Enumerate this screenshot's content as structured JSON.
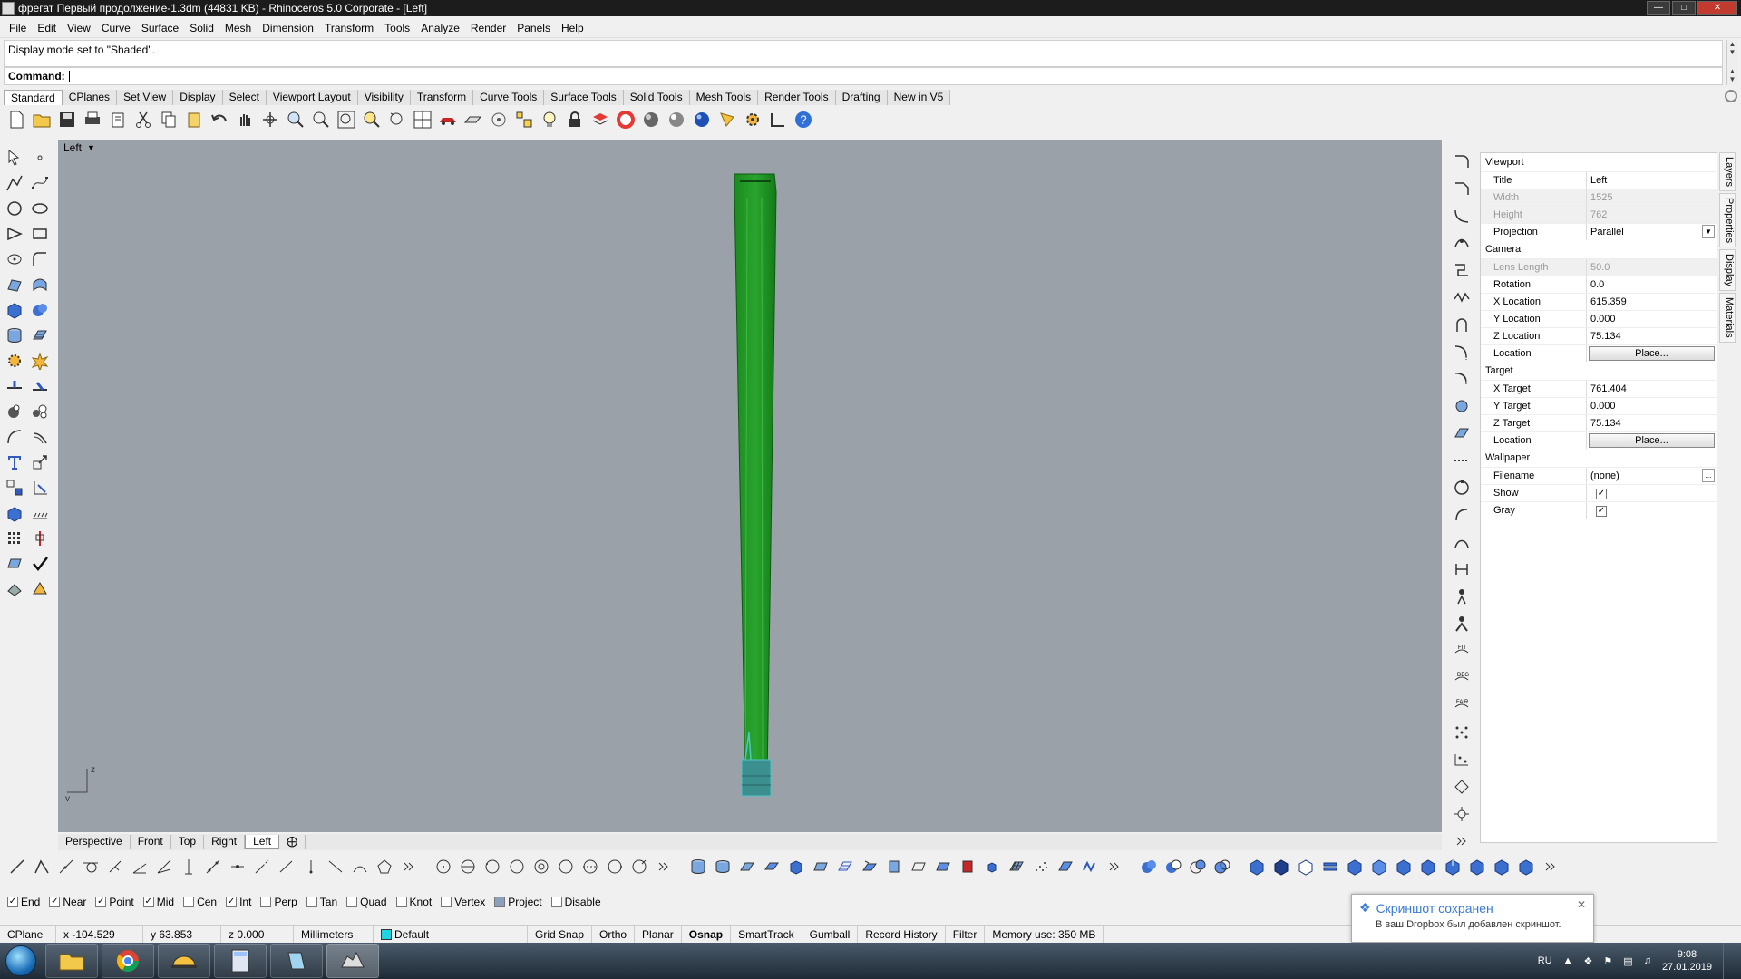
{
  "window": {
    "title": "фрегат Первый продолжение-1.3dm (44831 KB) - Rhinoceros  5.0 Corporate - [Left]"
  },
  "menu": [
    "File",
    "Edit",
    "View",
    "Curve",
    "Surface",
    "Solid",
    "Mesh",
    "Dimension",
    "Transform",
    "Tools",
    "Analyze",
    "Render",
    "Panels",
    "Help"
  ],
  "command": {
    "history": "Display mode set to \"Shaded\".",
    "label": "Command:",
    "value": ""
  },
  "toolbar_tabs": [
    "Standard",
    "CPlanes",
    "Set View",
    "Display",
    "Select",
    "Viewport Layout",
    "Visibility",
    "Transform",
    "Curve Tools",
    "Surface Tools",
    "Solid Tools",
    "Mesh Tools",
    "Render Tools",
    "Drafting",
    "New in V5"
  ],
  "active_toolbar_tab": "Standard",
  "viewport": {
    "name": "Left",
    "background": "#9ba1a9",
    "axis_labels": {
      "vertical": "z",
      "horizontal": "y"
    }
  },
  "viewport_tabs": [
    "Perspective",
    "Front",
    "Top",
    "Right",
    "Left"
  ],
  "active_viewport_tab": "Left",
  "properties": {
    "viewport_section": "Viewport",
    "title": {
      "label": "Title",
      "value": "Left"
    },
    "width": {
      "label": "Width",
      "value": "1525"
    },
    "height": {
      "label": "Height",
      "value": "762"
    },
    "projection": {
      "label": "Projection",
      "value": "Parallel"
    },
    "camera_section": "Camera",
    "lens_length": {
      "label": "Lens Length",
      "value": "50.0"
    },
    "rotation": {
      "label": "Rotation",
      "value": "0.0"
    },
    "x_location": {
      "label": "X Location",
      "value": "615.359"
    },
    "y_location": {
      "label": "Y Location",
      "value": "0.000"
    },
    "z_location": {
      "label": "Z Location",
      "value": "75.134"
    },
    "camera_location": {
      "label": "Location",
      "button": "Place..."
    },
    "target_section": "Target",
    "x_target": {
      "label": "X Target",
      "value": "761.404"
    },
    "y_target": {
      "label": "Y Target",
      "value": "0.000"
    },
    "z_target": {
      "label": "Z Target",
      "value": "75.134"
    },
    "target_location": {
      "label": "Location",
      "button": "Place..."
    },
    "wallpaper_section": "Wallpaper",
    "filename": {
      "label": "Filename",
      "value": "(none)",
      "button": "..."
    },
    "show": {
      "label": "Show",
      "checked": true
    },
    "gray": {
      "label": "Gray",
      "checked": true
    }
  },
  "side_tabs": [
    "Layers",
    "Properties",
    "Display",
    "Materials"
  ],
  "osnaps": [
    {
      "label": "End",
      "checked": true
    },
    {
      "label": "Near",
      "checked": true
    },
    {
      "label": "Point",
      "checked": true
    },
    {
      "label": "Mid",
      "checked": true
    },
    {
      "label": "Cen",
      "checked": false
    },
    {
      "label": "Int",
      "checked": true
    },
    {
      "label": "Perp",
      "checked": false
    },
    {
      "label": "Tan",
      "checked": false
    },
    {
      "label": "Quad",
      "checked": false
    },
    {
      "label": "Knot",
      "checked": false
    },
    {
      "label": "Vertex",
      "checked": false
    },
    {
      "label": "Project",
      "checked": false,
      "filled": true
    },
    {
      "label": "Disable",
      "checked": false
    }
  ],
  "status": {
    "cplane": "CPlane",
    "x": "x -104.529",
    "y": "y 63.853",
    "z": "z 0.000",
    "units": "Millimeters",
    "layer": "Default",
    "layer_color": "#22d3e0",
    "grid_snap": "Grid Snap",
    "ortho": "Ortho",
    "planar": "Planar",
    "osnap": "Osnap",
    "smarttrack": "SmartTrack",
    "gumball": "Gumball",
    "record_history": "Record History",
    "filter": "Filter",
    "memory": "Memory use: 350 MB"
  },
  "toast": {
    "title": "Скриншот сохранен",
    "body": "В ваш Dropbox был добавлен скриншот."
  },
  "tray": {
    "lang": "RU",
    "time": "9:08",
    "date": "27.01.2019"
  },
  "colors": {
    "model_green": "#1f9a22",
    "model_dark": "#0c5e12",
    "model_cyan": "#4fc4c8"
  }
}
